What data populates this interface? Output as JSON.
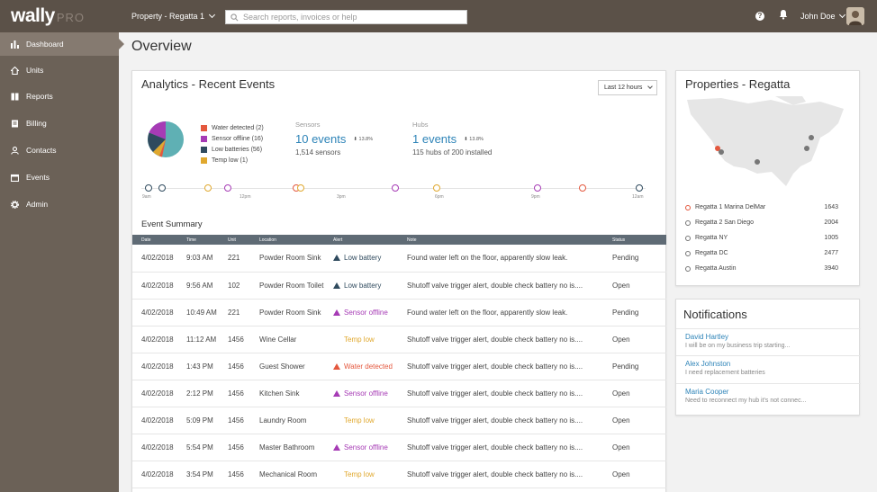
{
  "app": {
    "logo": "wally",
    "logo_suffix": "PRO"
  },
  "topbar": {
    "property_select": "Property - Regatta 1",
    "search_placeholder": "Search reports, invoices or help",
    "user_name": "John Doe"
  },
  "sidebar": {
    "items": [
      {
        "label": "Dashboard",
        "icon": "bar-chart-icon",
        "active": true
      },
      {
        "label": "Units",
        "icon": "home-icon"
      },
      {
        "label": "Reports",
        "icon": "book-icon"
      },
      {
        "label": "Billing",
        "icon": "document-icon"
      },
      {
        "label": "Contacts",
        "icon": "user-icon"
      },
      {
        "label": "Events",
        "icon": "calendar-icon"
      },
      {
        "label": "Admin",
        "icon": "gear-icon"
      }
    ]
  },
  "page": {
    "title": "Overview"
  },
  "analytics": {
    "title": "Analytics - Recent Events",
    "range": "Last 12 hours",
    "legend": [
      {
        "label": "Water detected (2)",
        "color": "#e4583e"
      },
      {
        "label": "Sensor offline (16)",
        "color": "#a63bb5"
      },
      {
        "label": "Low batteries (56)",
        "color": "#2f4a5e"
      },
      {
        "label": "Temp low (1)",
        "color": "#e0a82e"
      }
    ],
    "sensors": {
      "label": "Sensors",
      "value": "10 events",
      "delta": "13.8%",
      "sub": "1,514 sensors"
    },
    "hubs": {
      "label": "Hubs",
      "value": "1 events",
      "delta": "13.8%",
      "sub": "115 hubs of 200 installed"
    },
    "timeline_labels": [
      "9am",
      "12pm",
      "3pm",
      "6pm",
      "9pm",
      "12am"
    ],
    "summary_title": "Event Summary",
    "columns": [
      "Date",
      "Time",
      "Unit",
      "Location",
      "Alert",
      "Note",
      "Status"
    ],
    "rows": [
      {
        "date": "4/02/2018",
        "time": "9:03 AM",
        "unit": "221",
        "location": "Powder Room Sink",
        "alert": "Low battery",
        "alert_type": "battery",
        "note": "Found water left on the floor, apparently slow leak.",
        "status": "Pending"
      },
      {
        "date": "4/02/2018",
        "time": "9:56 AM",
        "unit": "102",
        "location": "Powder Room Toilet",
        "alert": "Low battery",
        "alert_type": "battery",
        "note": "Shutoff valve trigger alert, double check battery no is....",
        "status": "Open"
      },
      {
        "date": "4/02/2018",
        "time": "10:49 AM",
        "unit": "221",
        "location": "Powder Room Sink",
        "alert": "Sensor offline",
        "alert_type": "offline",
        "note": "Found water left on the floor, apparently slow leak.",
        "status": "Pending"
      },
      {
        "date": "4/02/2018",
        "time": "11:12 AM",
        "unit": "1456",
        "location": "Wine Cellar",
        "alert": "Temp low",
        "alert_type": "temp",
        "note": "Shutoff valve trigger alert, double check battery no is....",
        "status": "Open"
      },
      {
        "date": "4/02/2018",
        "time": "1:43 PM",
        "unit": "1456",
        "location": "Guest Shower",
        "alert": "Water detected",
        "alert_type": "water",
        "note": "Shutoff valve trigger alert, double check battery no is....",
        "status": "Pending"
      },
      {
        "date": "4/02/2018",
        "time": "2:12 PM",
        "unit": "1456",
        "location": "Kitchen Sink",
        "alert": "Sensor offline",
        "alert_type": "offline",
        "note": "Shutoff valve trigger alert, double check battery no is....",
        "status": "Open"
      },
      {
        "date": "4/02/2018",
        "time": "5:09 PM",
        "unit": "1456",
        "location": "Laundry Room",
        "alert": "Temp low",
        "alert_type": "temp",
        "note": "Shutoff valve trigger alert, double check battery no is....",
        "status": "Open"
      },
      {
        "date": "4/02/2018",
        "time": "5:54 PM",
        "unit": "1456",
        "location": "Master Bathroom",
        "alert": "Sensor offline",
        "alert_type": "offline",
        "note": "Shutoff valve trigger alert, double check battery no is....",
        "status": "Open"
      },
      {
        "date": "4/02/2018",
        "time": "3:54 PM",
        "unit": "1456",
        "location": "Mechanical Room",
        "alert": "Temp low",
        "alert_type": "temp",
        "note": "Shutoff valve trigger alert, double check battery no is....",
        "status": "Open"
      }
    ]
  },
  "properties": {
    "title": "Properties - Regatta",
    "items": [
      {
        "name": "Regatta 1 Marina DelMar",
        "value": "1643",
        "highlight": true
      },
      {
        "name": "Regatta 2 San Diego",
        "value": "2004"
      },
      {
        "name": "Regatta NY",
        "value": "1005"
      },
      {
        "name": "Regatta DC",
        "value": "2477"
      },
      {
        "name": "Regatta Austin",
        "value": "3940"
      }
    ]
  },
  "notifications": {
    "title": "Notifications",
    "items": [
      {
        "name": "David Hartley",
        "message": "I will be on my business trip starting..."
      },
      {
        "name": "Alex Johnston",
        "message": "I need replacement batteries"
      },
      {
        "name": "Maria Cooper",
        "message": "Need to reconnect my hub it's not connec..."
      }
    ]
  },
  "colors": {
    "topbar": "#5b5148",
    "sidebar": "#6b6157",
    "accent": "#2e84b8",
    "battery": "#2f4a5e",
    "offline": "#a63bb5",
    "temp": "#e0a82e",
    "water": "#e4583e"
  }
}
